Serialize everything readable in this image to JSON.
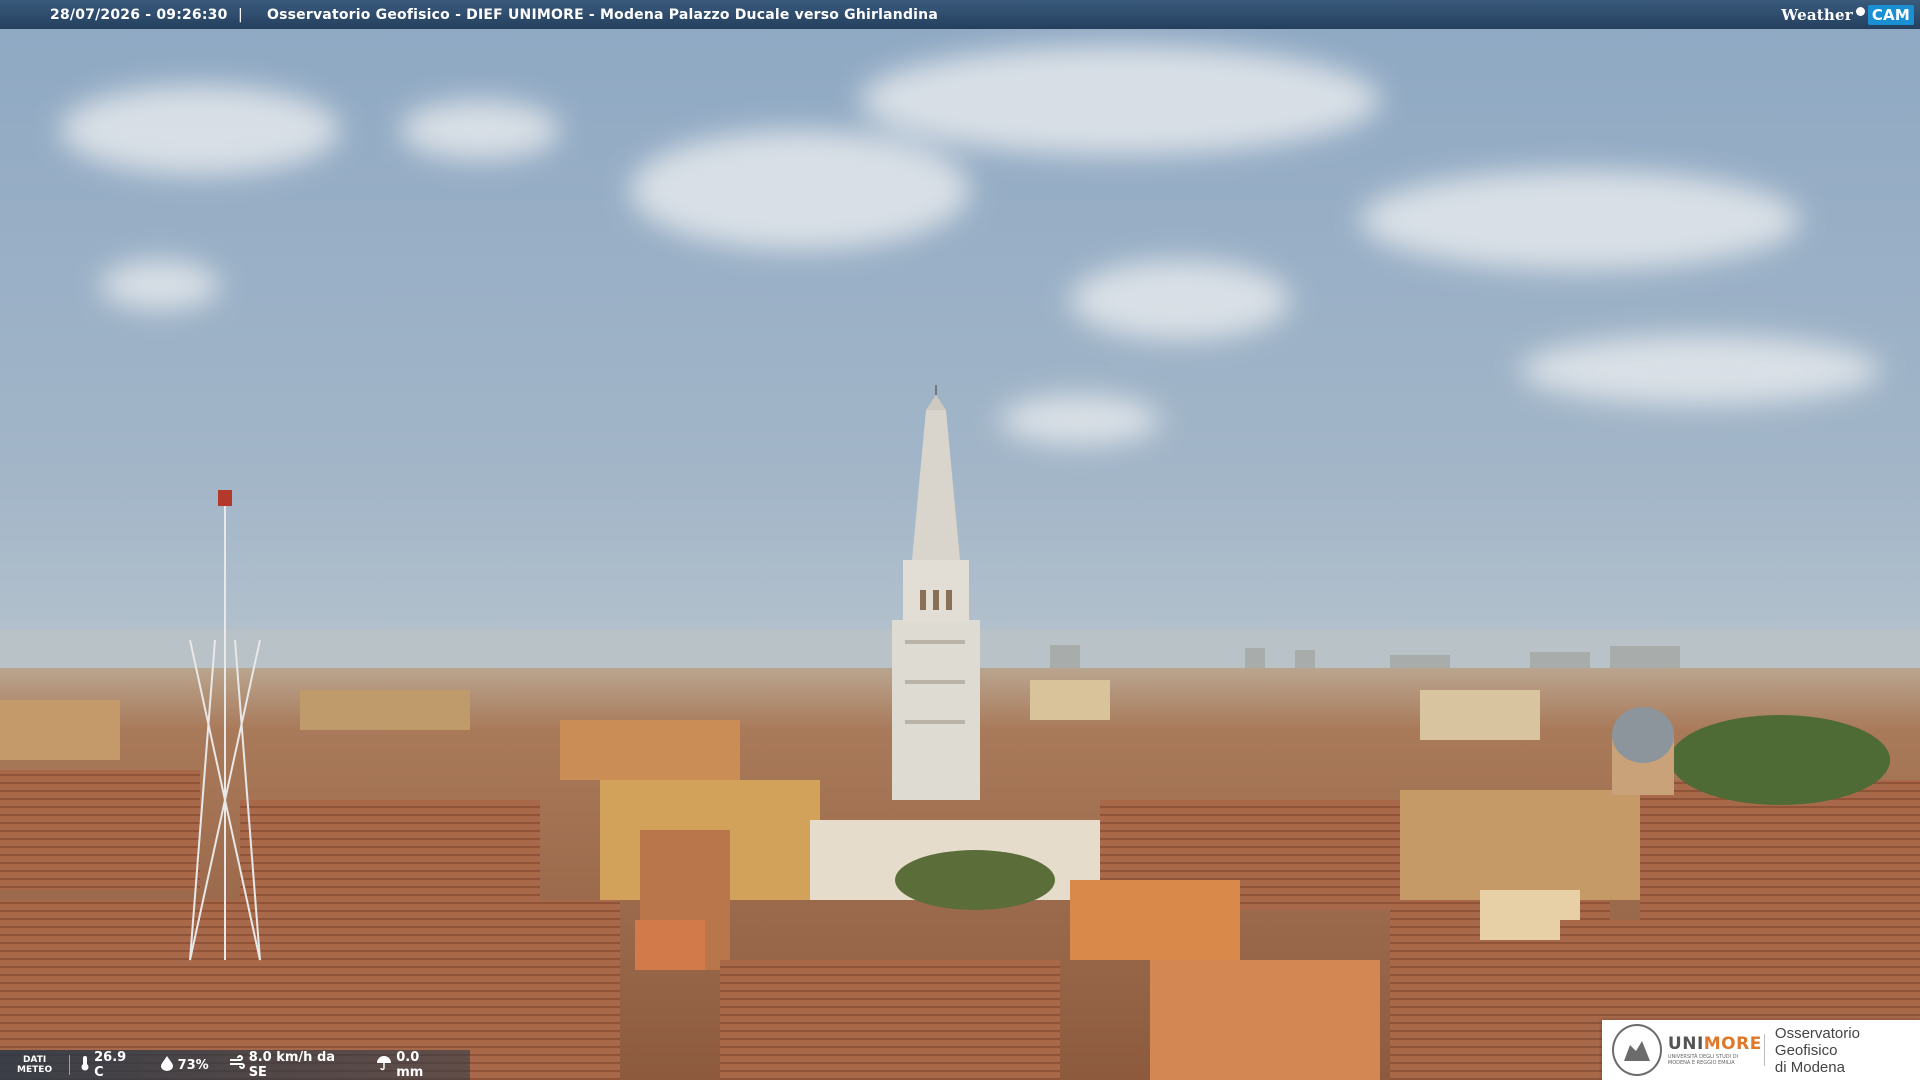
{
  "header": {
    "timestamp": "28/07/2026 - 09:26:30",
    "separator": "|",
    "title": "Osservatorio Geofisico - DIEF UNIMORE - Modena Palazzo Ducale verso Ghirlandina"
  },
  "brand": {
    "weather": "Weather",
    "cam": "CAM"
  },
  "meteo": {
    "label_top": "DATI",
    "label_bottom": "METEO",
    "temperature": "26.9 C",
    "humidity": "73%",
    "wind": "8.0 km/h da SE",
    "rain": "0.0 mm"
  },
  "logo": {
    "uni_name_a": "UNI",
    "uni_name_b": "MORE",
    "uni_sub_1": "UNIVERSITÀ DEGLI STUDI DI",
    "uni_sub_2": "MODENA E REGGIO EMILIA",
    "obs_line1": "Osservatorio Geofisico",
    "obs_line2": "di Modena"
  },
  "colors": {
    "sky_top": "#8fa9c2",
    "sky_bottom": "#b7c4cc",
    "roof": "#a86a48",
    "accent_cam": "#1a8fd4",
    "accent_unimore": "#e0782a"
  }
}
